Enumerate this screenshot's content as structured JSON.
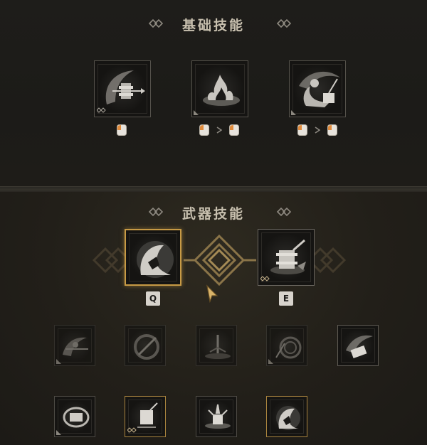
{
  "basic_section": {
    "title": "基础技能",
    "skills": [
      {
        "icon": "hammer-swing-icon",
        "input": [
          "left-mouse-icon"
        ]
      },
      {
        "icon": "fire-burst-icon",
        "input": [
          "left-mouse-icon",
          "left-mouse-icon"
        ]
      },
      {
        "icon": "crouch-strike-icon",
        "input": [
          "left-mouse-icon",
          "left-mouse-icon"
        ]
      }
    ]
  },
  "weapon_section": {
    "title": "武器技能",
    "equipped": [
      {
        "icon": "hooded-figure-icon",
        "key": "Q"
      },
      {
        "icon": "hammer-smash-icon",
        "key": "E"
      }
    ],
    "row1_icons": [
      "dash-strike-icon",
      "spin-slash-icon",
      "ground-slam-icon",
      "whirl-icon",
      "hammer-throw-icon"
    ],
    "row2_icons": [
      "shield-ring-icon",
      "fist-smash-icon",
      "impact-burst-icon",
      "hooded-figure-icon"
    ]
  },
  "colors": {
    "accent_gold": "#c79a45",
    "mouse_orange": "#e08a3a",
    "key_bg": "#d7d3cc"
  }
}
